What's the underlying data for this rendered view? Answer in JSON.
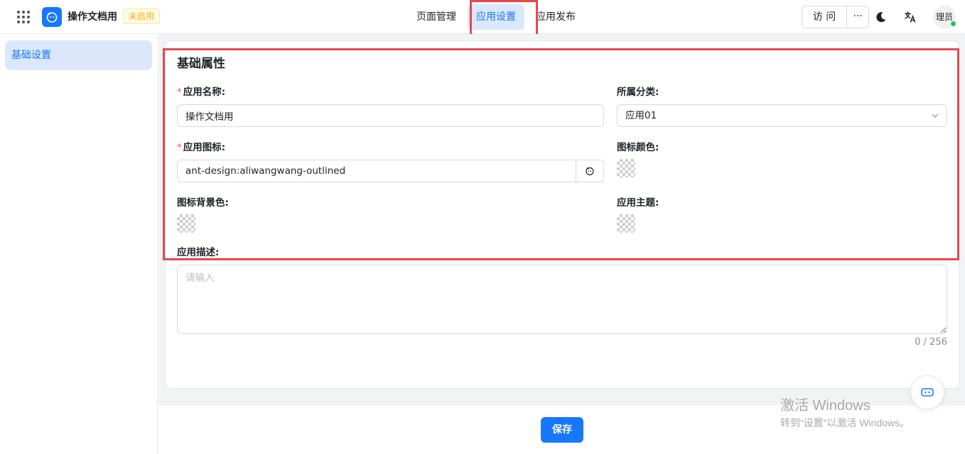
{
  "header": {
    "app_title": "操作文档用",
    "status_badge": "未启用",
    "nav_tabs": [
      {
        "label": "页面管理",
        "active": false
      },
      {
        "label": "应用设置",
        "active": true
      },
      {
        "label": "应用发布",
        "active": false
      }
    ],
    "visit_label": "访 问",
    "more_label": "···",
    "avatar_text": "理员"
  },
  "sidebar": {
    "items": [
      {
        "label": "基础设置",
        "active": true
      }
    ]
  },
  "form": {
    "section_title": "基础属性",
    "app_name": {
      "label": "应用名称:",
      "required_mark": "*",
      "value": "操作文档用"
    },
    "category": {
      "label": "所属分类:",
      "value": "应用01"
    },
    "app_icon": {
      "label": "应用图标:",
      "required_mark": "*",
      "value": "ant-design:aliwangwang-outlined"
    },
    "icon_color": {
      "label": "图标颜色:"
    },
    "icon_bg_color": {
      "label": "图标背景色:"
    },
    "app_theme": {
      "label": "应用主题:"
    },
    "description": {
      "label": "应用描述:",
      "placeholder": "请输入",
      "value": "",
      "counter": "0 / 256"
    }
  },
  "footer": {
    "save_label": "保存"
  },
  "watermark": {
    "title": "激活 Windows",
    "subtitle": "转到“设置”以激活 Windows。"
  },
  "colors": {
    "primary": "#1677ff",
    "active_bg": "#dbe8fb",
    "badge_text": "#faad14",
    "highlight": "#e5484d",
    "online": "#22c55e"
  },
  "icons": [
    "apps-grid-icon",
    "app-logo-icon",
    "moon-icon",
    "translate-icon",
    "chevron-down-icon",
    "aliwangwang-icon",
    "chat-bot-icon"
  ]
}
